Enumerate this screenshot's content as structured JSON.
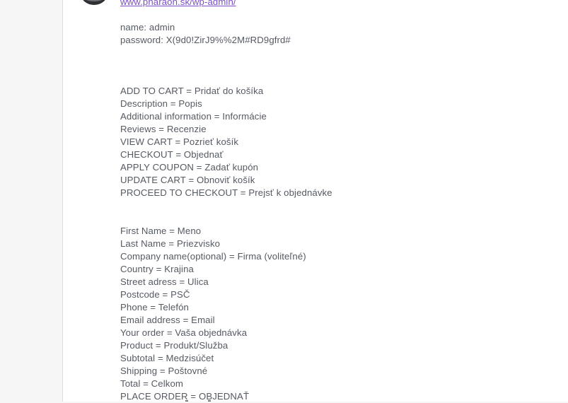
{
  "post": {
    "link": "www.pharaon.sk/wp-admin/",
    "credentials": [
      "name: admin",
      "password: X(9d0!ZirJ9%%2M#RD9gfrd#"
    ],
    "translations_group1": [
      "ADD TO CART = Pridať do košíka",
      "Description = Popis",
      "Additional information = Informácie",
      "Reviews = Recenzie",
      "VIEW CART = Pozrieť košík",
      "CHECKOUT = Objednať",
      "APPLY COUPON = Zadať kupón",
      "UPDATE CART = Obnoviť košík",
      "PROCEED TO CHECKOUT = Prejsť k objednávke"
    ],
    "translations_group2": [
      "First Name = Meno",
      "Last Name = Priezvisko",
      "Company name(optional) = Firma (voliteľné)",
      "Country = Krajina",
      "Street adress = Ulica",
      "Postcode = PSČ",
      "Phone = Telefón",
      "Email address = Email",
      "Your order = Vaša objednávka",
      "Product = Produkt/Služba",
      "Subtotal = Medzisúčet",
      "Shipping = Poštovné",
      "Total = Celkom",
      "PLACE ORDER = OBJEDNAŤ"
    ]
  },
  "colors": {
    "text": "#555a62",
    "link": "#7b4fc4",
    "background": "#f6f6f6",
    "panel": "#ffffff"
  }
}
